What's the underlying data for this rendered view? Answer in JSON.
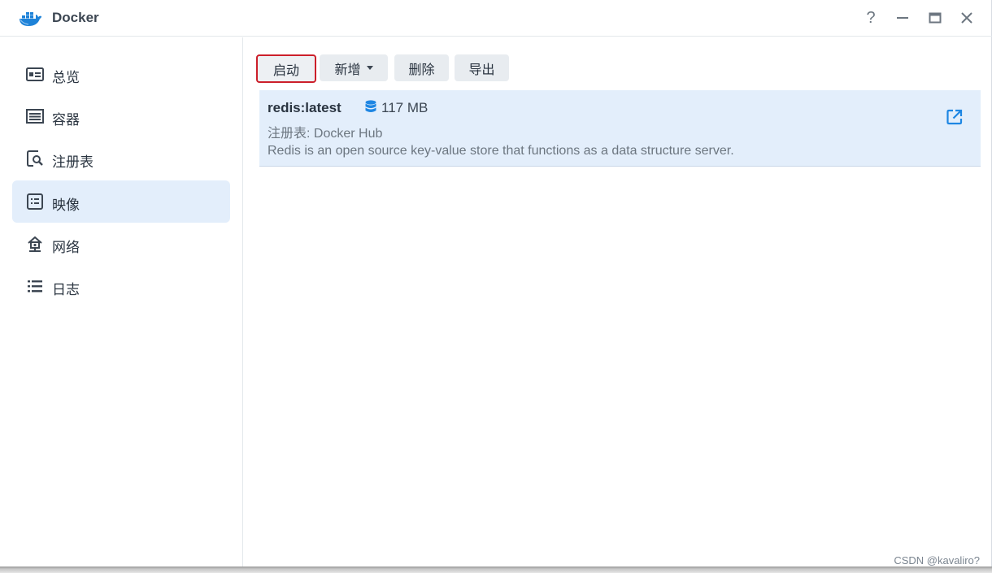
{
  "window": {
    "title": "Docker",
    "logo_icon": "docker-whale-icon",
    "controls": {
      "help": "?",
      "minimize": "—",
      "maximize": "▭",
      "close": "✕"
    }
  },
  "sidebar": {
    "items": [
      {
        "label": "总览",
        "icon": "overview-icon",
        "active": false
      },
      {
        "label": "容器",
        "icon": "container-icon",
        "active": false
      },
      {
        "label": "注册表",
        "icon": "registry-search-icon",
        "active": false
      },
      {
        "label": "映像",
        "icon": "image-icon",
        "active": true
      },
      {
        "label": "网络",
        "icon": "network-icon",
        "active": false
      },
      {
        "label": "日志",
        "icon": "log-list-icon",
        "active": false
      }
    ]
  },
  "toolbar": {
    "start_label": "启动",
    "add_label": "新增",
    "delete_label": "删除",
    "export_label": "导出"
  },
  "images": [
    {
      "name": "redis:latest",
      "size": "117 MB",
      "registry": "注册表: Docker Hub",
      "description": "Redis is an open source key-value store that functions as a data structure server."
    }
  ],
  "watermark": "CSDN @kavaliro?",
  "colors": {
    "accent": "#1e86e3",
    "active_bg": "#e3eefb",
    "highlight_border": "#cc1f2a"
  }
}
